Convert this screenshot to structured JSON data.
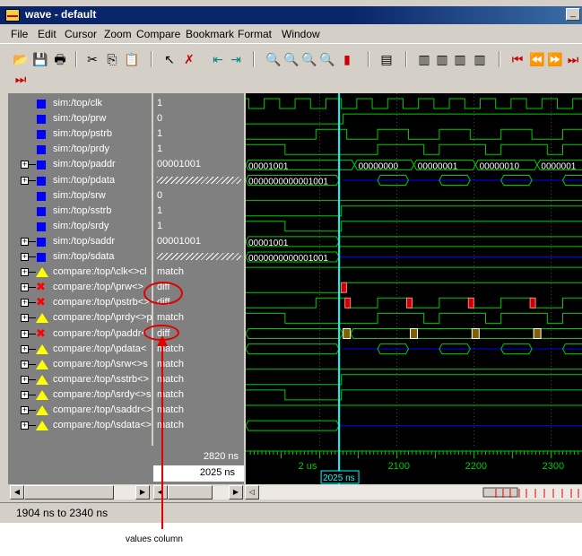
{
  "window": {
    "title": "wave - default",
    "icon": "wave-app-icon"
  },
  "menu": [
    "File",
    "Edit",
    "Cursor",
    "Zoom",
    "Compare",
    "Bookmark",
    "Format",
    "Window"
  ],
  "signals": [
    {
      "name": "sim:/top/clk",
      "value": "1",
      "icon": "signal-square-icon",
      "expand": false,
      "marker": "blue"
    },
    {
      "name": "sim:/top/prw",
      "value": "0",
      "icon": "signal-square-icon",
      "expand": false,
      "marker": "blue"
    },
    {
      "name": "sim:/top/pstrb",
      "value": "1",
      "icon": "signal-square-icon",
      "expand": false,
      "marker": "blue"
    },
    {
      "name": "sim:/top/prdy",
      "value": "1",
      "icon": "signal-square-icon",
      "expand": false,
      "marker": "blue"
    },
    {
      "name": "sim:/top/paddr",
      "value": "00001001",
      "icon": "signal-square-icon",
      "expand": true,
      "marker": "blue"
    },
    {
      "name": "sim:/top/pdata",
      "value": "",
      "icon": "signal-square-icon",
      "expand": true,
      "marker": "blue",
      "hatched": true
    },
    {
      "name": "sim:/top/srw",
      "value": "0",
      "icon": "signal-square-icon",
      "expand": false,
      "marker": "blue"
    },
    {
      "name": "sim:/top/sstrb",
      "value": "1",
      "icon": "signal-square-icon",
      "expand": false,
      "marker": "blue"
    },
    {
      "name": "sim:/top/srdy",
      "value": "1",
      "icon": "signal-square-icon",
      "expand": false,
      "marker": "blue"
    },
    {
      "name": "sim:/top/saddr",
      "value": "00001001",
      "icon": "signal-square-icon",
      "expand": true,
      "marker": "blue"
    },
    {
      "name": "sim:/top/sdata",
      "value": "",
      "icon": "signal-square-icon",
      "expand": true,
      "marker": "blue",
      "hatched": true
    },
    {
      "name": "compare:/top/\\clk<>cl",
      "value": "match",
      "icon": "warning-triangle-icon",
      "expand": true,
      "marker": "tri"
    },
    {
      "name": "compare:/top/\\prw<>",
      "value": "diff",
      "icon": "diff-x-icon",
      "expand": true,
      "marker": "x"
    },
    {
      "name": "compare:/top/\\pstrb<>",
      "value": "diff",
      "icon": "diff-x-icon",
      "expand": true,
      "marker": "x"
    },
    {
      "name": "compare:/top/\\prdy<>p",
      "value": "match",
      "icon": "warning-triangle-icon",
      "expand": true,
      "marker": "tri"
    },
    {
      "name": "compare:/top/\\paddr<",
      "value": "diff",
      "icon": "diff-x-icon",
      "expand": true,
      "marker": "x"
    },
    {
      "name": "compare:/top/\\pdata<",
      "value": "match",
      "icon": "warning-triangle-icon",
      "expand": true,
      "marker": "tri"
    },
    {
      "name": "compare:/top/\\srw<>s",
      "value": "match",
      "icon": "warning-triangle-icon",
      "expand": true,
      "marker": "tri"
    },
    {
      "name": "compare:/top/\\sstrb<>",
      "value": "match",
      "icon": "warning-triangle-icon",
      "expand": true,
      "marker": "tri"
    },
    {
      "name": "compare:/top/\\srdy<>s",
      "value": "match",
      "icon": "warning-triangle-icon",
      "expand": true,
      "marker": "tri"
    },
    {
      "name": "compare:/top/\\saddr<>",
      "value": "match",
      "icon": "warning-triangle-icon",
      "expand": true,
      "marker": "tri"
    },
    {
      "name": "compare:/top/\\sdata<>",
      "value": "match",
      "icon": "warning-triangle-icon",
      "expand": true,
      "marker": "tri"
    }
  ],
  "bus_labels": {
    "paddr": [
      "00001001",
      "00000000",
      "00000001",
      "00000010",
      "0000001"
    ],
    "pdata": "0000000000001001",
    "saddr": "00001001",
    "sdata": "0000000000001001"
  },
  "cursor": {
    "time_ns": 2025,
    "label": "2025 ns"
  },
  "footer": {
    "end_time": "2820 ns",
    "cursor_time": "2025 ns"
  },
  "time_axis": {
    "labels": [
      "2 us",
      "2100",
      "2200",
      "2300"
    ],
    "range_ns": [
      1904,
      2340
    ]
  },
  "status": "1904 ns to 2340 ns",
  "annotation": {
    "text": "values column"
  },
  "colors": {
    "wave": "#00cc00",
    "cursor": "#00ffff",
    "bus_value_line": "#0000ff",
    "diff": "#cc0000",
    "annotation": "#e00000"
  }
}
